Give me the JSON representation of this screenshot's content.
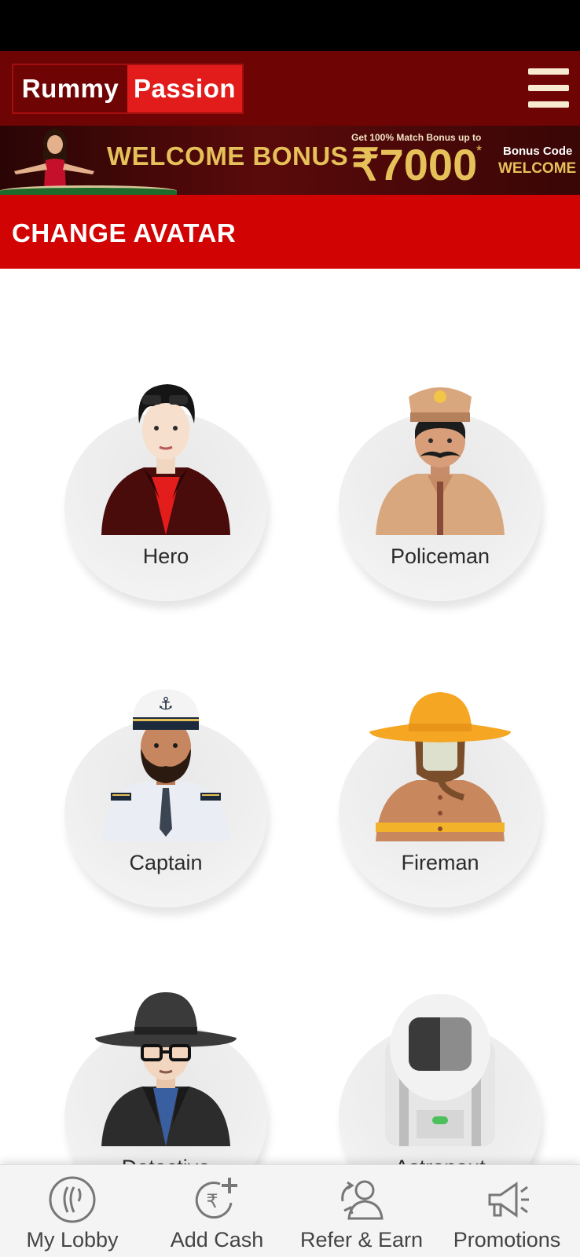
{
  "header": {
    "logo_left": "Rummy",
    "logo_right": "Passion",
    "menu_icon": "hamburger-menu-icon"
  },
  "banner": {
    "headline": "WELCOME BONUS",
    "match_text": "Get 100% Match Bonus up to",
    "amount": "₹7000",
    "amount_mark": "*",
    "code_label": "Bonus Code",
    "code_value": "WELCOME"
  },
  "page": {
    "title": "CHANGE AVATAR"
  },
  "avatars": [
    {
      "label": "Hero",
      "icon": "hero-avatar-icon"
    },
    {
      "label": "Policeman",
      "icon": "policeman-avatar-icon"
    },
    {
      "label": "Captain",
      "icon": "captain-avatar-icon"
    },
    {
      "label": "Fireman",
      "icon": "fireman-avatar-icon"
    },
    {
      "label": "Detective",
      "icon": "detective-avatar-icon"
    },
    {
      "label": "Astronaut",
      "icon": "astronaut-avatar-icon"
    }
  ],
  "bottom_nav": [
    {
      "label": "My Lobby",
      "icon": "lobby-icon"
    },
    {
      "label": "Add Cash",
      "icon": "add-cash-icon"
    },
    {
      "label": "Refer & Earn",
      "icon": "refer-earn-icon"
    },
    {
      "label": "Promotions",
      "icon": "megaphone-icon"
    }
  ],
  "colors": {
    "header_bg": "#6e0404",
    "title_bar_bg": "#d20303",
    "logo_accent": "#e21b1b",
    "gold": "#e6c15a"
  }
}
